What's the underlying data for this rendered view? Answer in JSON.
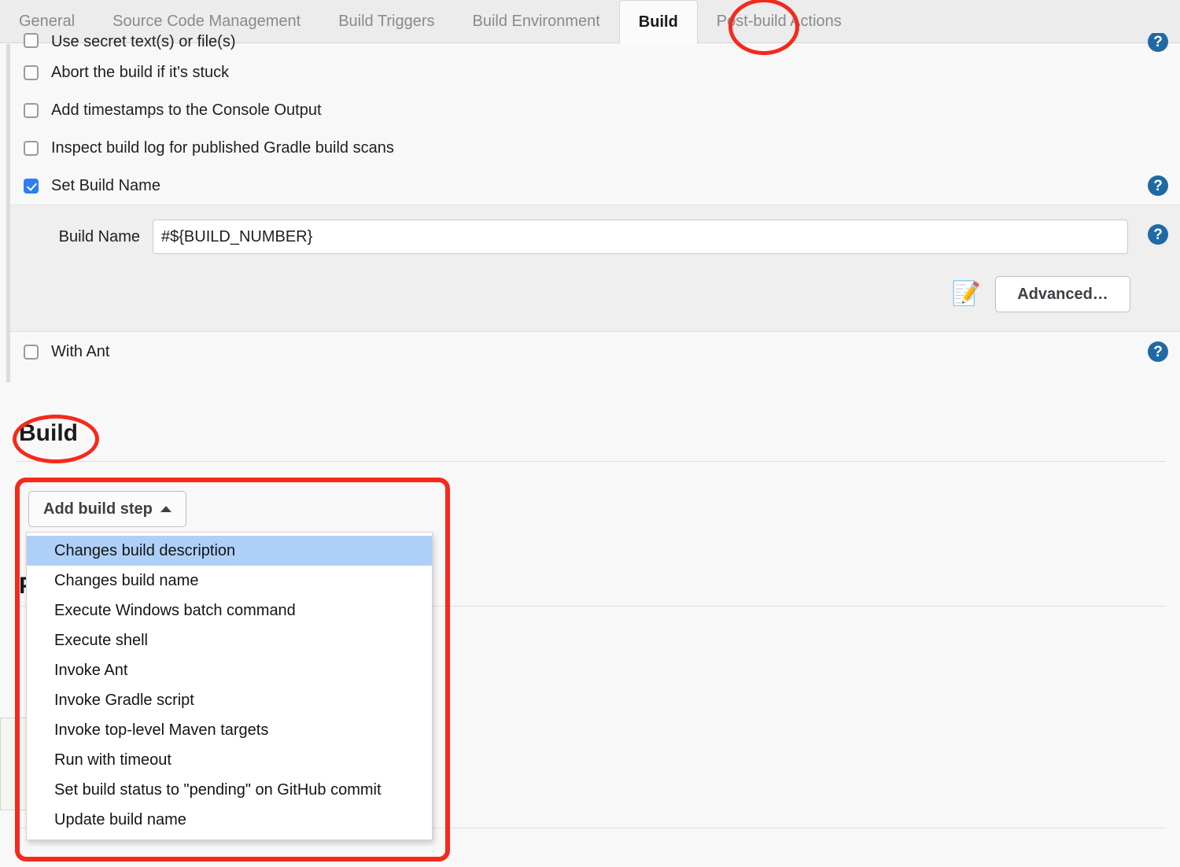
{
  "tabs": [
    {
      "label": "General",
      "active": false
    },
    {
      "label": "Source Code Management",
      "active": false
    },
    {
      "label": "Build Triggers",
      "active": false
    },
    {
      "label": "Build Environment",
      "active": false
    },
    {
      "label": "Build",
      "active": true
    },
    {
      "label": "Post-build Actions",
      "active": false
    }
  ],
  "checkbox_rows": [
    {
      "label": "Use secret text(s) or file(s)",
      "checked": false,
      "help": true
    },
    {
      "label": "Abort the build if it's stuck",
      "checked": false,
      "help": false
    },
    {
      "label": "Add timestamps to the Console Output",
      "checked": false,
      "help": false
    },
    {
      "label": "Inspect build log for published Gradle build scans",
      "checked": false,
      "help": false
    },
    {
      "label": "Set Build Name",
      "checked": true,
      "help": true
    }
  ],
  "build_name_panel": {
    "field_label": "Build Name",
    "field_value": "#${BUILD_NUMBER}",
    "field_placeholder": "",
    "notepad_icon": "notepad-pencil-icon",
    "notepad_glyph": "📝",
    "advanced_label": "Advanced…",
    "help": true
  },
  "with_ant_row": {
    "label": "With Ant",
    "checked": false,
    "help": true
  },
  "build_section": {
    "heading": "Build",
    "add_build_step_label": "Add build step",
    "caret_icon": "caret-up-icon"
  },
  "occluded_heading": "P",
  "dropdown_items": [
    {
      "label": "Changes build description",
      "highlighted": true
    },
    {
      "label": "Changes build name",
      "highlighted": false
    },
    {
      "label": "Execute Windows batch command",
      "highlighted": false
    },
    {
      "label": "Execute shell",
      "highlighted": false
    },
    {
      "label": "Invoke Ant",
      "highlighted": false
    },
    {
      "label": "Invoke Gradle script",
      "highlighted": false
    },
    {
      "label": "Invoke top-level Maven targets",
      "highlighted": false
    },
    {
      "label": "Run with timeout",
      "highlighted": false
    },
    {
      "label": "Set build status to \"pending\" on GitHub commit",
      "highlighted": false
    },
    {
      "label": "Update build name",
      "highlighted": false
    }
  ],
  "help_icon_glyph": "?",
  "colors": {
    "annotation_red": "#f5291c",
    "active_checkbox_blue": "#2b7ef5",
    "help_icon_blue": "#1f6aa5",
    "menu_highlight_blue": "#aed0f8",
    "page_background": "#f8f8f8",
    "tabbar_background": "#ececec",
    "subpanel_background": "#efefef"
  }
}
